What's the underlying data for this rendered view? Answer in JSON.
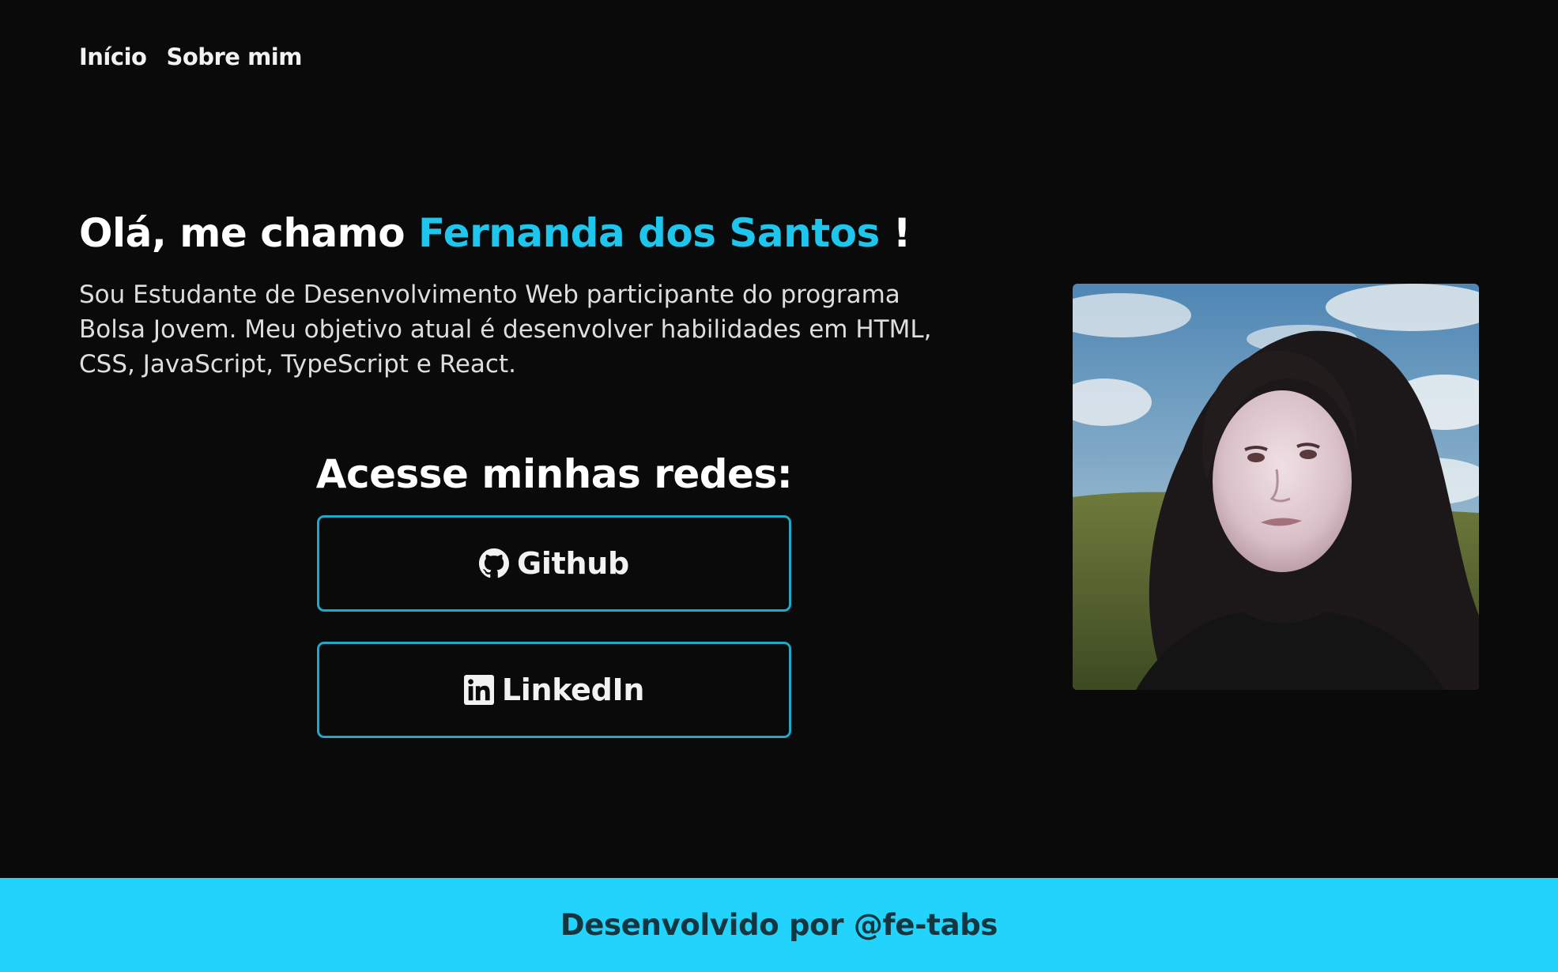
{
  "nav": {
    "items": [
      {
        "label": "Início"
      },
      {
        "label": "Sobre mim"
      }
    ]
  },
  "hero": {
    "greeting": "Olá, me chamo ",
    "name": "Fernanda dos Santos",
    "exclamation": " !",
    "bio": "Sou Estudante de Desenvolvimento Web participante do programa Bolsa Jovem. Meu objetivo atual é desenvolver habilidades em HTML, CSS, JavaScript, TypeScript e React."
  },
  "social": {
    "heading": "Acesse minhas redes:",
    "buttons": [
      {
        "label": "Github",
        "icon": "github-icon"
      },
      {
        "label": "LinkedIn",
        "icon": "linkedin-icon"
      }
    ]
  },
  "footer": {
    "text": "Desenvolvido por @fe-tabs"
  },
  "colors": {
    "background": "#0b0a0a",
    "accent": "#1ec5ec",
    "button_border": "#1fa8c7",
    "footer_bg": "#22d3fb",
    "footer_text": "#143640"
  }
}
